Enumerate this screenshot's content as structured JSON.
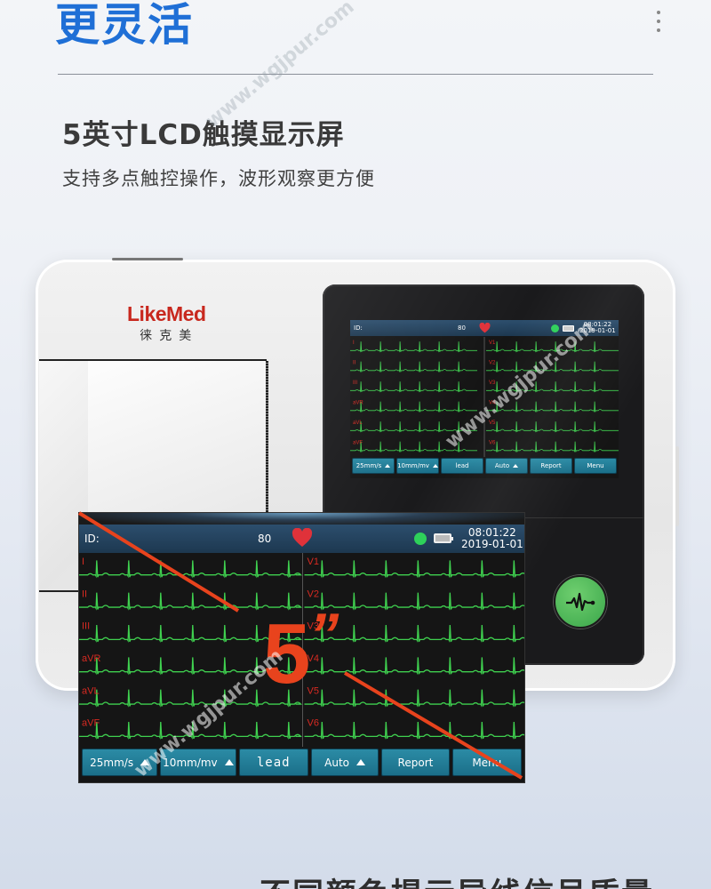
{
  "header": {
    "headline": "更灵活",
    "more_icon": "more-vertical-icon"
  },
  "feature": {
    "title": "5英寸LCD触摸显示屏",
    "subtitle": "支持多点触控操作，波形观察更方便"
  },
  "device": {
    "brand_en": "LikeMed",
    "brand_cn": "徕克美",
    "ecg_button_icon": "ecg-waveform-icon"
  },
  "screen": {
    "id_label": "ID:",
    "heart_rate": "80",
    "heart_icon": "heart-icon",
    "status_dot_color": "#2ed15a",
    "battery_icon": "battery-icon",
    "time": "08:01:22",
    "date": "2019-01-01",
    "leads_left": [
      "I",
      "II",
      "III",
      "aVR",
      "aVL",
      "aVF"
    ],
    "leads_right": [
      "V1",
      "V2",
      "V3",
      "V4",
      "V5",
      "V6"
    ],
    "trace_color": "#3fd04f",
    "lead_label_color": "#d82a22",
    "buttons": [
      {
        "label": "25mm/s",
        "has_arrow": true
      },
      {
        "label": "10mm/mv",
        "has_arrow": true
      },
      {
        "label": "lead",
        "has_arrow": false
      },
      {
        "label": "Auto",
        "has_arrow": true
      },
      {
        "label": "Report",
        "has_arrow": false
      },
      {
        "label": "Menu",
        "has_arrow": false
      }
    ]
  },
  "callout": {
    "size_label": "5",
    "size_unit": "”",
    "accent_color": "#e8431d"
  },
  "watermark": "www.wgjpur.com",
  "next_section": {
    "title": "不同颜色提示导线信号质量"
  }
}
